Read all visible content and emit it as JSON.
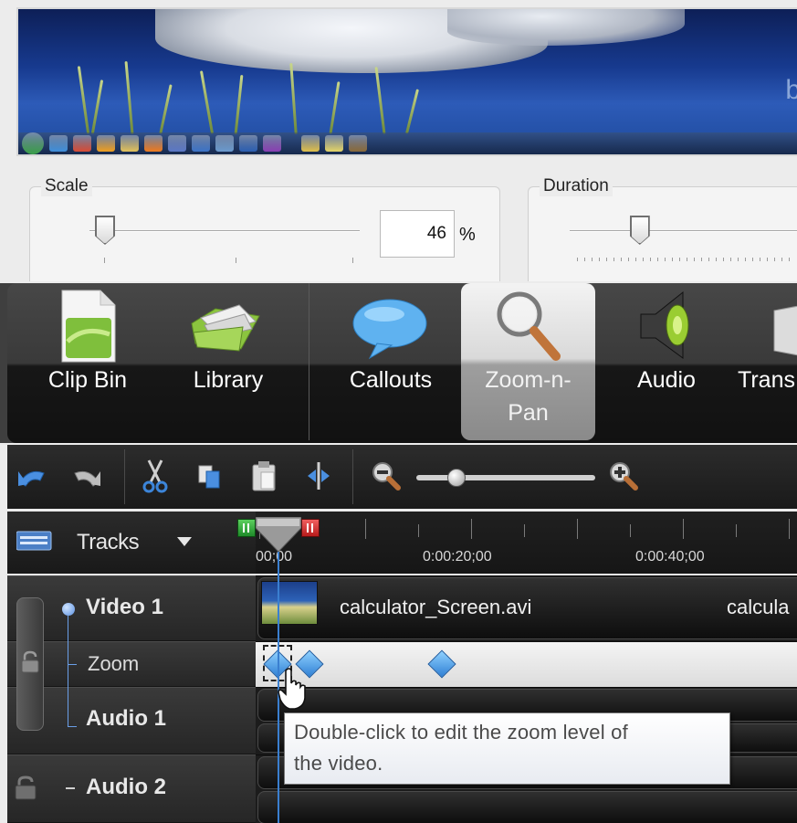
{
  "preview": {
    "watermark_letter": "b",
    "taskbar_icons": [
      {
        "name": "start-orb-icon",
        "color": "#3aa04a"
      },
      {
        "name": "internet-explorer-icon",
        "color": "#3e8fdc"
      },
      {
        "name": "chrome-icon",
        "color": "#d94b36"
      },
      {
        "name": "outlook-icon",
        "color": "#f0a020"
      },
      {
        "name": "file-explorer-icon",
        "color": "#e3c25a"
      },
      {
        "name": "media-player-icon",
        "color": "#f07b1e"
      },
      {
        "name": "paint-icon",
        "color": "#5b78c8"
      },
      {
        "name": "calculator-icon",
        "color": "#3b74c9"
      },
      {
        "name": "pen-icon",
        "color": "#6b9bd0"
      },
      {
        "name": "word-icon",
        "color": "#2b5fb3"
      },
      {
        "name": "onenote-icon",
        "color": "#8a3fb5"
      },
      {
        "name": "folder-icon",
        "color": "#e0c04b"
      },
      {
        "name": "notes-icon",
        "color": "#e6d668"
      },
      {
        "name": "joystick-icon",
        "color": "#8a6a3a"
      }
    ]
  },
  "properties": {
    "scale": {
      "label": "Scale",
      "value": "46",
      "unit": "%",
      "level": 0.0
    },
    "duration": {
      "label": "Duration",
      "level": 0.24
    }
  },
  "tabs": [
    {
      "id": "clip-bin",
      "label": "Clip Bin",
      "active": false
    },
    {
      "id": "library",
      "label": "Library",
      "active": false
    },
    {
      "id": "callouts",
      "label": "Callouts",
      "active": false
    },
    {
      "id": "zoom-n-pan",
      "label_line1": "Zoom-n-",
      "label_line2": "Pan",
      "active": true
    },
    {
      "id": "audio",
      "label": "Audio",
      "active": false
    },
    {
      "id": "transitions",
      "label": "Trans",
      "active": false
    }
  ],
  "toolbar": {
    "buttons": [
      "undo-icon",
      "redo-icon",
      "cut-icon",
      "copy-icon",
      "paste-icon",
      "split-icon",
      "zoom-out-icon",
      "zoom-in-icon"
    ],
    "zoom_level": 0.1
  },
  "timeline": {
    "tracks_label": "Tracks",
    "time_labels": [
      "00;00",
      "0:00:20;00",
      "0:00:40;00"
    ],
    "tracks": [
      {
        "name": "Video 1",
        "clip": "calculator_Screen.avi",
        "clip_overflow": "calcula"
      },
      {
        "name": "Zoom"
      },
      {
        "name": "Audio 1"
      },
      {
        "name": "Audio 2"
      }
    ]
  },
  "tooltip": {
    "line1": "Double-click to edit the zoom level of",
    "line2": "the video."
  },
  "colors": {
    "keyframe": "#3a8fe0",
    "playhead": "#3a7fd0",
    "marker_in": "#2fa63a",
    "marker_out": "#d23a3a"
  }
}
